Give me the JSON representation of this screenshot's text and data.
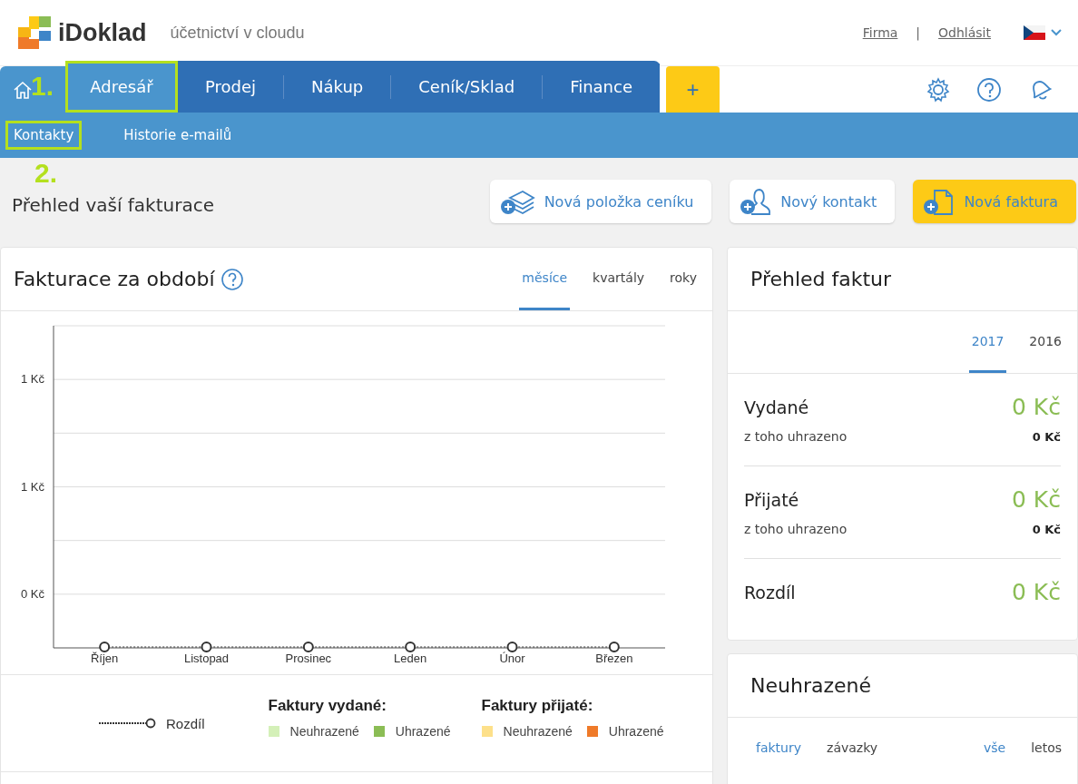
{
  "header": {
    "logo": "iDoklad",
    "tagline": "účetnictví v cloudu",
    "links": [
      {
        "label": "Firma"
      },
      {
        "label": "Odhlásit"
      }
    ],
    "separator": "|"
  },
  "nav": {
    "tabs": [
      {
        "label": "Adresář",
        "selected": true
      },
      {
        "label": "Prodej",
        "selected": false
      },
      {
        "label": "Nákup",
        "selected": false
      },
      {
        "label": "Ceník/Sklad",
        "selected": false
      },
      {
        "label": "Finance",
        "selected": false
      }
    ],
    "add": "+"
  },
  "subnav": [
    {
      "label": "Kontakty",
      "selected": true
    },
    {
      "label": "Historie e-mailů",
      "selected": false
    }
  ],
  "annotations": [
    "1.",
    "2."
  ],
  "page_title": "Přehled vaší fakturace",
  "actions": [
    {
      "label": "Nová položka ceníku",
      "kind": "pricelist"
    },
    {
      "label": "Nový kontakt",
      "kind": "contact"
    },
    {
      "label": "Nová faktura",
      "kind": "invoice"
    }
  ],
  "billing_card": {
    "title": "Fakturace za období",
    "period_tabs": [
      {
        "label": "měsíce",
        "selected": true
      },
      {
        "label": "kvartály",
        "selected": false
      },
      {
        "label": "roky",
        "selected": false
      }
    ],
    "chart": {
      "x_labels": [
        "Říjen",
        "Listopad",
        "Prosinec",
        "Leden",
        "Únor",
        "Březen"
      ],
      "y_labels": [
        "1 Kč",
        "1 Kč",
        "0 Kč"
      ]
    },
    "legend": {
      "line_label": "Rozdíl",
      "groups": [
        {
          "title": "Faktury vydané:",
          "items": [
            {
              "label": "Neuhrazené",
              "color": "#d4f0b8"
            },
            {
              "label": "Uhrazené",
              "color": "#8bbd55"
            }
          ]
        },
        {
          "title": "Faktury přijaté:",
          "items": [
            {
              "label": "Neuhrazené",
              "color": "#fde08a"
            },
            {
              "label": "Uhrazené",
              "color": "#ef7a29"
            }
          ]
        }
      ]
    }
  },
  "overview_card": {
    "title": "Přehled faktur",
    "year_tabs": [
      {
        "label": "2017",
        "selected": true
      },
      {
        "label": "2016",
        "selected": false
      }
    ],
    "rows": [
      {
        "label": "Vydané",
        "amount": "0 Kč",
        "sub_label": "z toho uhrazeno",
        "sub_amount": "0 Kč"
      },
      {
        "label": "Přijaté",
        "amount": "0 Kč",
        "sub_label": "z toho uhrazeno",
        "sub_amount": "0 Kč"
      },
      {
        "label": "Rozdíl",
        "amount": "0 Kč"
      }
    ]
  },
  "unpaid_card": {
    "title": "Neuhrazené",
    "type_tabs": [
      {
        "label": "faktury",
        "selected": true
      },
      {
        "label": "závazky",
        "selected": false
      }
    ],
    "range_tabs": [
      {
        "label": "vše",
        "selected": true
      },
      {
        "label": "letos",
        "selected": false
      }
    ]
  }
}
